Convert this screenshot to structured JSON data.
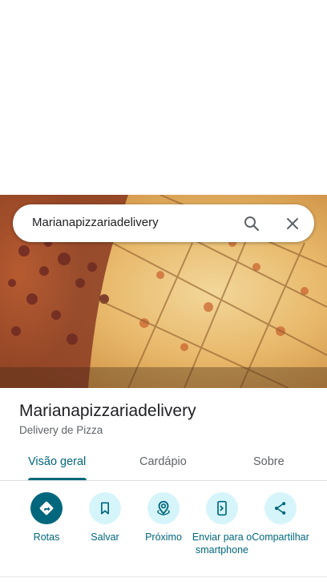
{
  "search": {
    "query": "Marianapizzariadelivery",
    "search_icon": "search-icon",
    "close_icon": "close-icon"
  },
  "place": {
    "name": "Marianapizzariadelivery",
    "category": "Delivery de Pizza",
    "photo": "pizza-photo"
  },
  "tabs": [
    {
      "label": "Visão geral",
      "active": true
    },
    {
      "label": "Cardápio",
      "active": false
    },
    {
      "label": "Sobre",
      "active": false
    }
  ],
  "actions": [
    {
      "label": "Rotas",
      "icon": "directions-icon"
    },
    {
      "label": "Salvar",
      "icon": "bookmark-icon"
    },
    {
      "label": "Próximo",
      "icon": "nearby-icon"
    },
    {
      "label": "Enviar para o smartphone",
      "icon": "send-to-phone-icon"
    },
    {
      "label": "Compartilhar",
      "icon": "share-icon"
    }
  ],
  "colors": {
    "accent": "#00677c",
    "action_bg": "#d6f5fb"
  }
}
